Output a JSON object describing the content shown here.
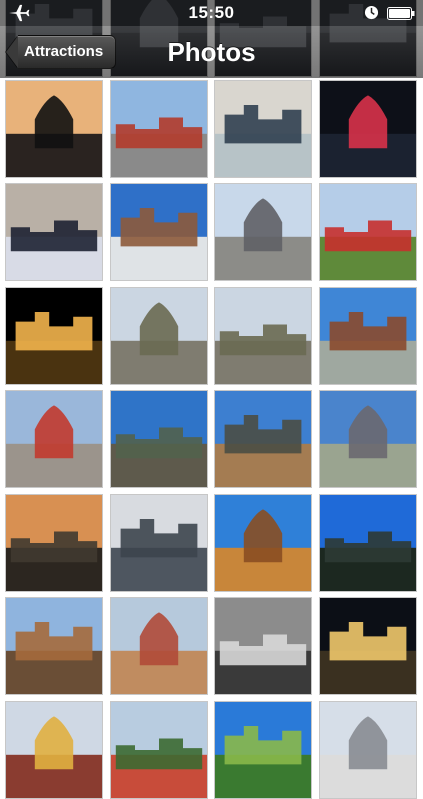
{
  "status_bar": {
    "time": "15:50",
    "icons": [
      "airplane-icon",
      "clock-icon",
      "battery-icon"
    ]
  },
  "nav": {
    "back_label": "Attractions",
    "title": "Photos"
  },
  "photos": [
    {
      "name": "photo-little-mermaid-statue",
      "sky": "#e8b27a",
      "ground": "#2a2320",
      "accent": "#111111"
    },
    {
      "name": "photo-city-square-street",
      "sky": "#8fb6e0",
      "ground": "#8a8a8a",
      "accent": "#b23b2b"
    },
    {
      "name": "photo-skater-ice-rink",
      "sky": "#d9d6cf",
      "ground": "#b7c3c7",
      "accent": "#304050"
    },
    {
      "name": "photo-night-lights-building",
      "sky": "#0d1018",
      "ground": "#1b2230",
      "accent": "#d8324a"
    },
    {
      "name": "photo-couple-snow-dusk",
      "sky": "#b9b0a6",
      "ground": "#d8dbe6",
      "accent": "#1e2233"
    },
    {
      "name": "photo-town-hall-square",
      "sky": "#2f70c8",
      "ground": "#dfe3e6",
      "accent": "#8d5a3b"
    },
    {
      "name": "photo-plaza-sculpture",
      "sky": "#c8d8ea",
      "ground": "#8c8c88",
      "accent": "#5f6066"
    },
    {
      "name": "photo-column-statue",
      "sky": "#b5cde8",
      "ground": "#5f8a3a",
      "accent": "#c6302e"
    },
    {
      "name": "photo-palace-night-reflection",
      "sky": "#000000",
      "ground": "#4a3310",
      "accent": "#f2b44c"
    },
    {
      "name": "photo-rosenborg-castle-a",
      "sky": "#cbd6e2",
      "ground": "#7f7c70",
      "accent": "#6a6a52"
    },
    {
      "name": "photo-rosenborg-castle-b",
      "sky": "#cbd6e2",
      "ground": "#7f7c70",
      "accent": "#6a6a52"
    },
    {
      "name": "photo-parliament-spire",
      "sky": "#3f86d6",
      "ground": "#9fa8a0",
      "accent": "#8a4a2e"
    },
    {
      "name": "photo-horse-carriage-street",
      "sky": "#9ab7da",
      "ground": "#9b948c",
      "accent": "#c23a2e"
    },
    {
      "name": "photo-gefion-fountain-a",
      "sky": "#2f74c8",
      "ground": "#5e5a4c",
      "accent": "#52624c"
    },
    {
      "name": "photo-gefion-fountain-b",
      "sky": "#3d7fd0",
      "ground": "#a47c52",
      "accent": "#4a4e44"
    },
    {
      "name": "photo-gothic-church",
      "sky": "#4a84cc",
      "ground": "#9aa490",
      "accent": "#6a6870"
    },
    {
      "name": "photo-sunset-church-trees",
      "sky": "#d89052",
      "ground": "#2c2620",
      "accent": "#403a30"
    },
    {
      "name": "photo-gefion-bulls-statue",
      "sky": "#d8dbe0",
      "ground": "#4e5660",
      "accent": "#3d454e"
    },
    {
      "name": "photo-round-tower-brick",
      "sky": "#2f80d8",
      "ground": "#c8863a",
      "accent": "#8a4e22"
    },
    {
      "name": "photo-dark-blue-sky-trees",
      "sky": "#1f6ad8",
      "ground": "#1c2820",
      "accent": "#2d3a34"
    },
    {
      "name": "photo-church-round-tower",
      "sky": "#8fb4de",
      "ground": "#6a4e36",
      "accent": "#a56a3c"
    },
    {
      "name": "photo-round-tower-houses",
      "sky": "#b6c9dc",
      "ground": "#c08c60",
      "accent": "#b04a38"
    },
    {
      "name": "photo-stone-bust-bw",
      "sky": "#8c8c8c",
      "ground": "#3a3a3a",
      "accent": "#d8d8d8"
    },
    {
      "name": "photo-cobblestone-night-street",
      "sky": "#0c0f16",
      "ground": "#3a3020",
      "accent": "#f0c86a"
    },
    {
      "name": "photo-nyhavn-houses",
      "sky": "#cfd8e4",
      "ground": "#8a3c30",
      "accent": "#e0b040"
    },
    {
      "name": "photo-colorful-houses-trees",
      "sky": "#b8cce0",
      "ground": "#c84c3a",
      "accent": "#3c6a32"
    },
    {
      "name": "photo-tree-blue-sky",
      "sky": "#2a7ad8",
      "ground": "#3a7a30",
      "accent": "#8ab84a"
    },
    {
      "name": "photo-white-building",
      "sky": "#d6dee8",
      "ground": "#dcdcdc",
      "accent": "#888c92"
    }
  ]
}
